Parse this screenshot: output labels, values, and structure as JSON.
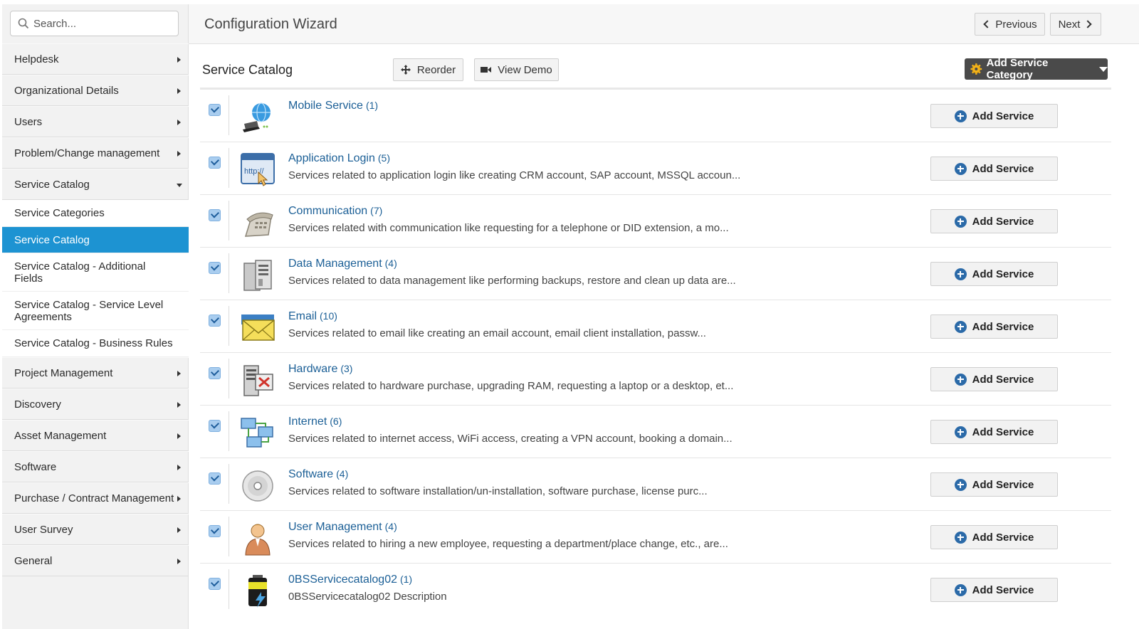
{
  "search": {
    "placeholder": "Search..."
  },
  "header": {
    "title": "Configuration Wizard",
    "previous_label": "Previous",
    "next_label": "Next"
  },
  "sidebar": {
    "items_top": [
      {
        "label": "Helpdesk"
      },
      {
        "label": "Organizational Details"
      },
      {
        "label": "Users"
      },
      {
        "label": "Problem/Change management"
      },
      {
        "label": "Service Catalog",
        "expanded": true
      }
    ],
    "sub_items": [
      {
        "label": "Service Categories"
      },
      {
        "label": "Service Catalog",
        "active": true
      },
      {
        "label": "Service Catalog - Additional Fields"
      },
      {
        "label": "Service Catalog - Service Level Agreements"
      },
      {
        "label": "Service Catalog - Business Rules"
      }
    ],
    "items_bottom": [
      {
        "label": "Project Management"
      },
      {
        "label": "Discovery"
      },
      {
        "label": "Asset Management"
      },
      {
        "label": "Software"
      },
      {
        "label": "Purchase / Contract Management"
      },
      {
        "label": "User Survey"
      },
      {
        "label": "General"
      }
    ]
  },
  "catalog": {
    "title": "Service Catalog",
    "reorder_label": "Reorder",
    "view_demo_label": "View Demo",
    "add_category_label": "Add Service Category",
    "add_service_label": "Add Service",
    "categories": [
      {
        "name": "Mobile Service",
        "count": "(1)",
        "description": "",
        "icon": "mobile-service-icon"
      },
      {
        "name": "Application Login",
        "count": "(5)",
        "description": "Services related to application login like creating CRM account, SAP account, MSSQL accoun...",
        "icon": "application-login-icon"
      },
      {
        "name": "Communication",
        "count": "(7)",
        "description": "Services related with communication like requesting for a telephone or DID extension, a mo...",
        "icon": "telephone-icon"
      },
      {
        "name": "Data Management",
        "count": "(4)",
        "description": "Services related to data management like performing backups, restore and clean up data are...",
        "icon": "server-icon"
      },
      {
        "name": "Email",
        "count": "(10)",
        "description": "Services related to email like creating an email account, email client installation, passw...",
        "icon": "envelope-icon"
      },
      {
        "name": "Hardware",
        "count": "(3)",
        "description": "Services related to hardware purchase, upgrading RAM, requesting a laptop or a desktop, et...",
        "icon": "hardware-icon"
      },
      {
        "name": "Internet",
        "count": "(6)",
        "description": "Services related to internet access, WiFi access, creating a VPN account, booking a domain...",
        "icon": "network-icon"
      },
      {
        "name": "Software",
        "count": "(4)",
        "description": "Services related to software installation/un-installation, software purchase, license purc...",
        "icon": "disc-icon"
      },
      {
        "name": "User Management",
        "count": "(4)",
        "description": "Services related to hiring a new employee, requesting a department/place change, etc., are...",
        "icon": "user-icon"
      },
      {
        "name": "0BSServicecatalog02",
        "count": "(1)",
        "description": "0BSServicecatalog02 Description",
        "icon": "battery-icon"
      }
    ]
  },
  "colors": {
    "accent": "#1d93d2",
    "link": "#1b5f96",
    "dark_button": "#4a4a4a"
  }
}
